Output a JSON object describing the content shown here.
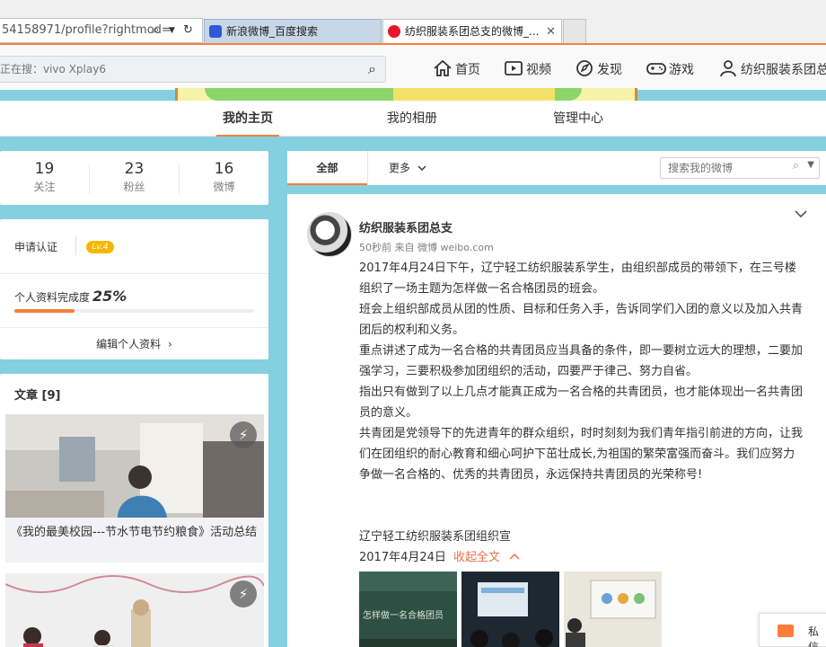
{
  "browser": {
    "address": "54158971/profile?rightmod=",
    "tabs": [
      {
        "label": "新浪微博_百度搜索"
      },
      {
        "label": "纺织服装系团总支的微博_..."
      }
    ]
  },
  "topnav": {
    "search_placeholder": "正在搜：vivo Xplay6",
    "items": [
      {
        "label": "首页",
        "icon": "home-icon"
      },
      {
        "label": "视频",
        "icon": "video-icon"
      },
      {
        "label": "发现",
        "icon": "compass-icon"
      },
      {
        "label": "游戏",
        "icon": "gamepad-icon"
      },
      {
        "label": "纺织服装系团总",
        "icon": "user-icon"
      }
    ],
    "accent": "#fa7d3c"
  },
  "profile_tabs": [
    "我的主页",
    "我的相册",
    "管理中心"
  ],
  "stats": [
    {
      "value": "19",
      "label": "关注"
    },
    {
      "value": "23",
      "label": "粉丝"
    },
    {
      "value": "16",
      "label": "微博"
    }
  ],
  "info": {
    "verify_label": "申请认证",
    "level_badge": "Lv.4",
    "completeness_label": "个人资料完成度",
    "completeness_value": "25%",
    "completeness_fraction": 0.25,
    "edit_label": "编辑个人资料",
    "edit_chevron": "›"
  },
  "articles": {
    "title": "文章 [9]",
    "first_caption": "《我的最美校园---节水节电节约粮食》活动总结"
  },
  "feed": {
    "tab_all": "全部",
    "tab_more": "更多",
    "search_placeholder": "搜索我的微博"
  },
  "post": {
    "author": "纺织服装系团总支",
    "meta": "50秒前 来自 微博 weibo.com",
    "paragraphs": [
      "2017年4月24日下午，辽宁轻工纺织服装系学生，由组织部成员的带领下，在三号楼组织了一场主题为怎样做一名合格团员的班会。",
      "班会上组织部成员从团的性质、目标和任务入手，告诉同学们入团的意义以及加入共青团后的权利和义务。",
      "重点讲述了成为一名合格的共青团员应当具备的条件，即一要树立远大的理想，二要加强学习，三要积极参加团组织的活动，四要严于律己、努力自省。",
      "指出只有做到了以上几点才能真正成为一名合格的共青团员，也才能体现出一名共青团员的意义。",
      "共青团是党领导下的先进青年的群众组织，时时刻刻为我们青年指引前进的方向，让我们在团组织的耐心教育和细心呵护下茁壮成长,为祖国的繁荣富强而奋斗。我们应努力争做一名合格的、优秀的共青团员，永远保持共青团员的光荣称号!"
    ],
    "signature": "辽宁轻工纺织服装系团组织宣",
    "date": "2017年4月24日",
    "collapse_label": "收起全文",
    "thumb1_text": "怎样做一名合格团员"
  },
  "chat": {
    "label": "私信"
  }
}
